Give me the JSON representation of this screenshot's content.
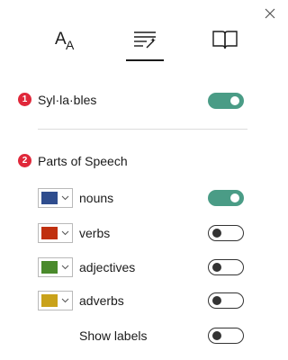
{
  "tabs": [
    {
      "icon": "text-size-icon",
      "selected": false
    },
    {
      "icon": "grammar-options-icon",
      "selected": true
    },
    {
      "icon": "reading-preferences-icon",
      "selected": false
    }
  ],
  "syllables": {
    "badge": "1",
    "label": "Syl·la·bles",
    "on": true
  },
  "parts_of_speech": {
    "badge": "2",
    "label": "Parts of Speech",
    "items": [
      {
        "label": "nouns",
        "color": "#2f4d8e",
        "on": true
      },
      {
        "label": "verbs",
        "color": "#c0300f",
        "on": false
      },
      {
        "label": "adjectives",
        "color": "#4a8a2c",
        "on": false
      },
      {
        "label": "adverbs",
        "color": "#c9a21a",
        "on": false
      }
    ],
    "show_labels": {
      "label": "Show labels",
      "on": false
    }
  },
  "colors": {
    "toggle_on": "#4a9c86",
    "badge": "#e0283a"
  }
}
